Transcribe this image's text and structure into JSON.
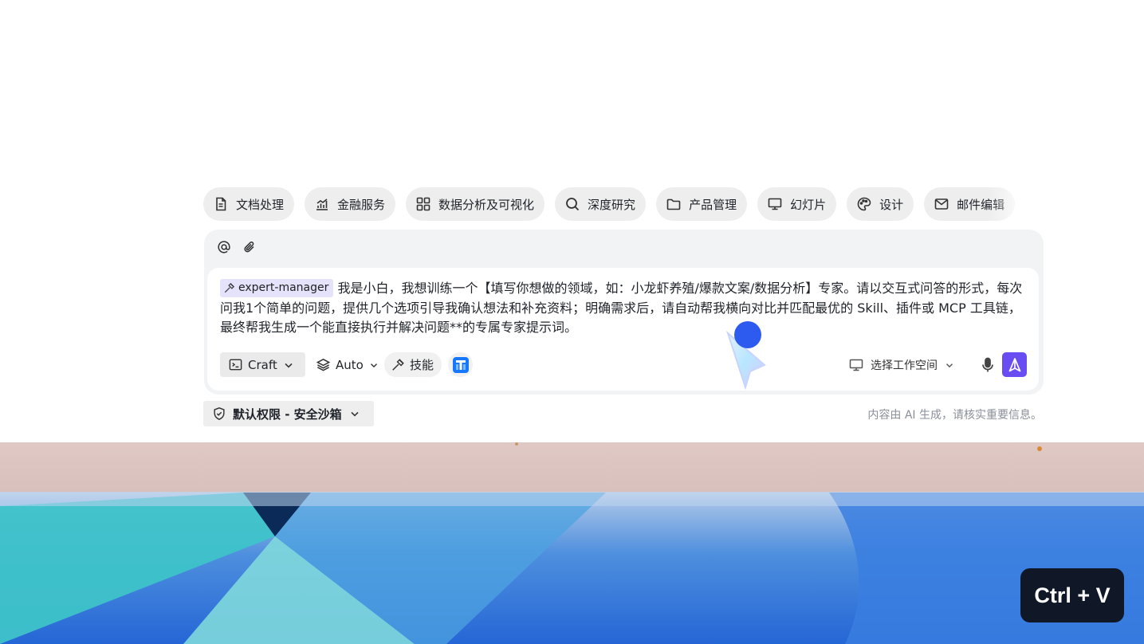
{
  "chips": [
    {
      "label": "文档处理",
      "icon": "document-icon"
    },
    {
      "label": "金融服务",
      "icon": "finance-chart-icon"
    },
    {
      "label": "数据分析及可视化",
      "icon": "grid-icon"
    },
    {
      "label": "深度研究",
      "icon": "search-icon"
    },
    {
      "label": "产品管理",
      "icon": "folder-icon"
    },
    {
      "label": "幻灯片",
      "icon": "monitor-icon"
    },
    {
      "label": "设计",
      "icon": "palette-icon"
    },
    {
      "label": "邮件编辑",
      "icon": "mail-icon"
    }
  ],
  "composer": {
    "tag_label": "expert-manager",
    "message": "我是小白，我想训练一个【填写你想做的领域，如：小龙虾养殖/爆款文案/数据分析】专家。请以交互式问答的形式，每次问我1个简单的问题，提供几个选项引导我确认想法和补充资料；明确需求后，请自动帮我横向对比并匹配最优的 Skill、插件或 MCP 工具链，最终帮我生成一个能直接执行并解决问题**的专属专家提示词。",
    "mode_label": "Craft",
    "model_label": "Auto",
    "skill_label": "技能",
    "workspace_label": "选择工作空间"
  },
  "permission_label": "默认权限 - 安全沙箱",
  "disclaimer": "内容由 AI 生成，请核实重要信息。",
  "keyboard_hint": "Ctrl + V",
  "colors": {
    "accent": "#6a4df2",
    "tag_bg": "#e5e2fb",
    "chip_bg": "#eeeeee",
    "cursor_dot": "#2d5bf0"
  }
}
